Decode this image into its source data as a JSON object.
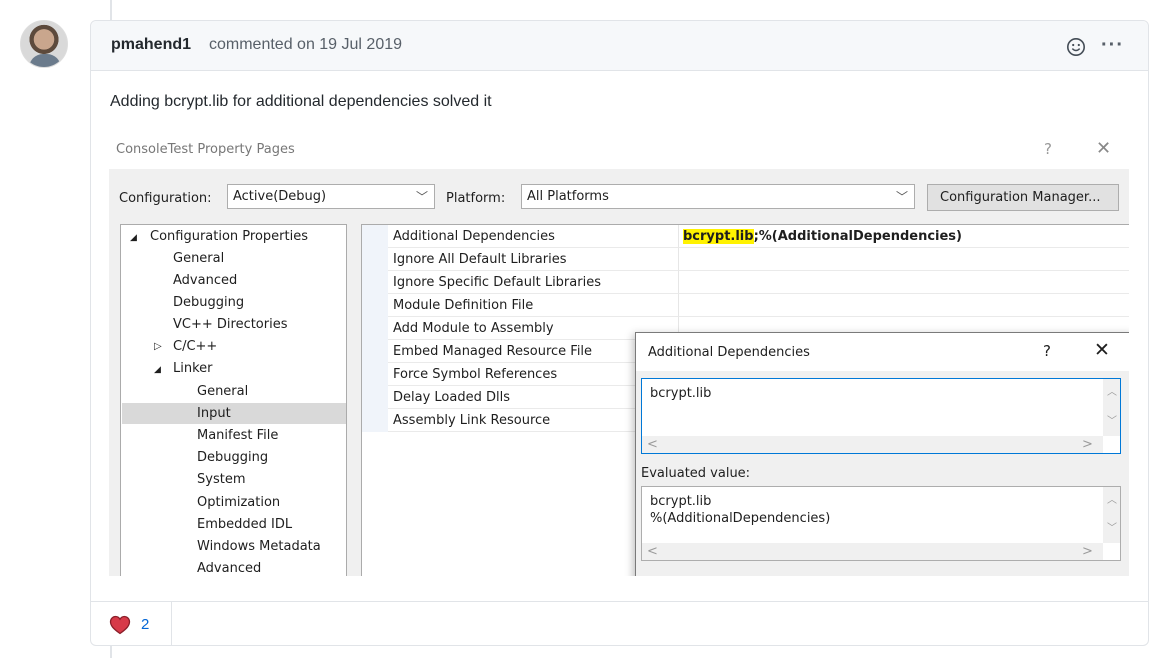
{
  "comment": {
    "author": "pmahend1",
    "meta": "commented on 19 Jul 2019",
    "body": "Adding bcrypt.lib for additional dependencies solved it",
    "icons": {
      "emoji": "smile-icon",
      "more": "ellipsis-icon"
    }
  },
  "screenshot": {
    "window_title": "ConsoleTest Property Pages",
    "help": "?",
    "close": "✕",
    "configuration_label": "Configuration:",
    "configuration_value": "Active(Debug)",
    "platform_label": "Platform:",
    "platform_value": "All Platforms",
    "config_manager_button": "Configuration Manager...",
    "tree": [
      {
        "label": "Configuration Properties",
        "expander": "◢"
      },
      {
        "label": "General"
      },
      {
        "label": "Advanced"
      },
      {
        "label": "Debugging"
      },
      {
        "label": "VC++ Directories"
      },
      {
        "label": "C/C++",
        "expander": "▷"
      },
      {
        "label": "Linker",
        "expander": "◢"
      },
      {
        "label": "General"
      },
      {
        "label": "Input",
        "selected": true
      },
      {
        "label": "Manifest File"
      },
      {
        "label": "Debugging"
      },
      {
        "label": "System"
      },
      {
        "label": "Optimization"
      },
      {
        "label": "Embedded IDL"
      },
      {
        "label": "Windows Metadata"
      },
      {
        "label": "Advanced"
      }
    ],
    "properties": [
      {
        "name": "Additional Dependencies",
        "value_highlight": "bcrypt.lib",
        "value_rest": ";%(AdditionalDependencies)"
      },
      {
        "name": "Ignore All Default Libraries"
      },
      {
        "name": "Ignore Specific Default Libraries"
      },
      {
        "name": "Module Definition File"
      },
      {
        "name": "Add Module to Assembly"
      },
      {
        "name": "Embed Managed Resource File"
      },
      {
        "name": "Force Symbol References"
      },
      {
        "name": "Delay Loaded Dlls"
      },
      {
        "name": "Assembly Link Resource"
      }
    ],
    "dialog": {
      "title": "Additional Dependencies",
      "help": "?",
      "close": "✕",
      "edit_value": "bcrypt.lib",
      "evaluated_label": "Evaluated value:",
      "evaluated_value": "bcrypt.lib\n%(AdditionalDependencies)"
    }
  },
  "reactions": [
    {
      "icon": "heart-icon",
      "count": "2",
      "color": "#d73a49"
    }
  ]
}
